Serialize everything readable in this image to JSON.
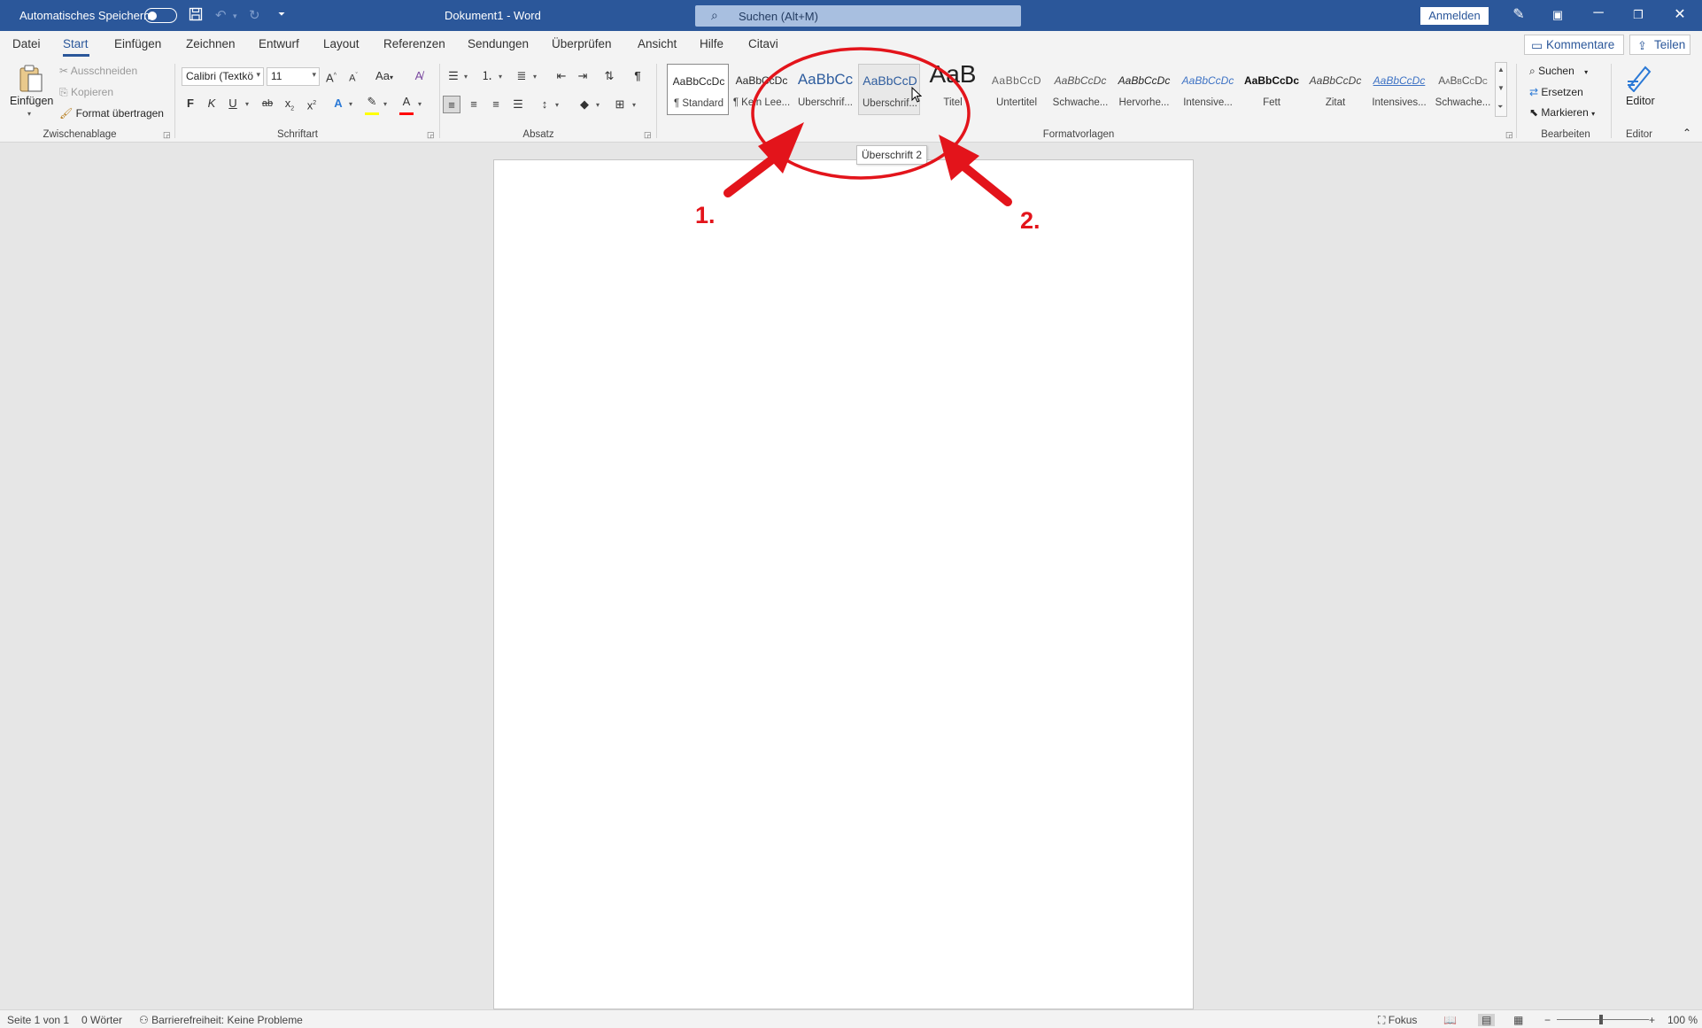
{
  "titlebar": {
    "autosave_label": "Automatisches Speichern",
    "doc_title": "Dokument1  -  Word",
    "search_placeholder": "Suchen (Alt+M)",
    "signin_label": "Anmelden"
  },
  "tabs": [
    "Datei",
    "Start",
    "Einfügen",
    "Zeichnen",
    "Entwurf",
    "Layout",
    "Referenzen",
    "Sendungen",
    "Überprüfen",
    "Ansicht",
    "Hilfe",
    "Citavi"
  ],
  "active_tab": "Start",
  "top_right": {
    "comments_label": "Kommentare",
    "share_label": "Teilen"
  },
  "clipboard": {
    "group_label": "Zwischenablage",
    "paste_label": "Einfügen",
    "cut_label": "Ausschneiden",
    "copy_label": "Kopieren",
    "format_painter_label": "Format übertragen"
  },
  "font": {
    "group_label": "Schriftart",
    "font_name": "Calibri (Textkö",
    "font_size": "11",
    "bold": "F",
    "italic": "K",
    "underline": "U",
    "strike": "ab",
    "case_label": "Aa",
    "grow_label": "A",
    "shrink_label": "A",
    "highlight_color": "#ffff00",
    "font_color": "#ff0000"
  },
  "paragraph": {
    "group_label": "Absatz"
  },
  "styles": {
    "group_label": "Formatvorlagen",
    "items": [
      {
        "preview": "AaBbCcDc",
        "label": "¶ Standard"
      },
      {
        "preview": "AaBbCcDc",
        "label": "¶ Kein Lee..."
      },
      {
        "preview": "AaBbCc",
        "label": "Überschrif..."
      },
      {
        "preview": "AaBbCcD",
        "label": "Überschrif..."
      },
      {
        "preview": "AaB",
        "label": "Titel"
      },
      {
        "preview": "AaBbCcD",
        "label": "Untertitel"
      },
      {
        "preview": "AaBbCcDc",
        "label": "Schwache..."
      },
      {
        "preview": "AaBbCcDc",
        "label": "Hervorhe..."
      },
      {
        "preview": "AaBbCcDc",
        "label": "Intensive..."
      },
      {
        "preview": "AaBbCcDc",
        "label": "Fett"
      },
      {
        "preview": "AaBbCcDc",
        "label": "Zitat"
      },
      {
        "preview": "AaBbCcDc",
        "label": "Intensives..."
      },
      {
        "preview": "AaBbCcDc",
        "label": "Schwache..."
      }
    ],
    "tooltip": "Überschrift 2"
  },
  "editing": {
    "group_label": "Bearbeiten",
    "find_label": "Suchen",
    "replace_label": "Ersetzen",
    "select_label": "Markieren"
  },
  "editor": {
    "group_label": "Editor",
    "button_label": "Editor"
  },
  "annotations": {
    "num1": "1.",
    "num2": "2.",
    "color": "#e3141b"
  },
  "status": {
    "page": "Seite 1 von 1",
    "words": "0 Wörter",
    "accessibility": "Barrierefreiheit: Keine Probleme",
    "focus": "Fokus",
    "zoom": "100 %"
  },
  "colors": {
    "brand": "#2b579a",
    "ribbon_bg": "#f3f3f3",
    "workspace_bg": "#e6e6e6"
  }
}
